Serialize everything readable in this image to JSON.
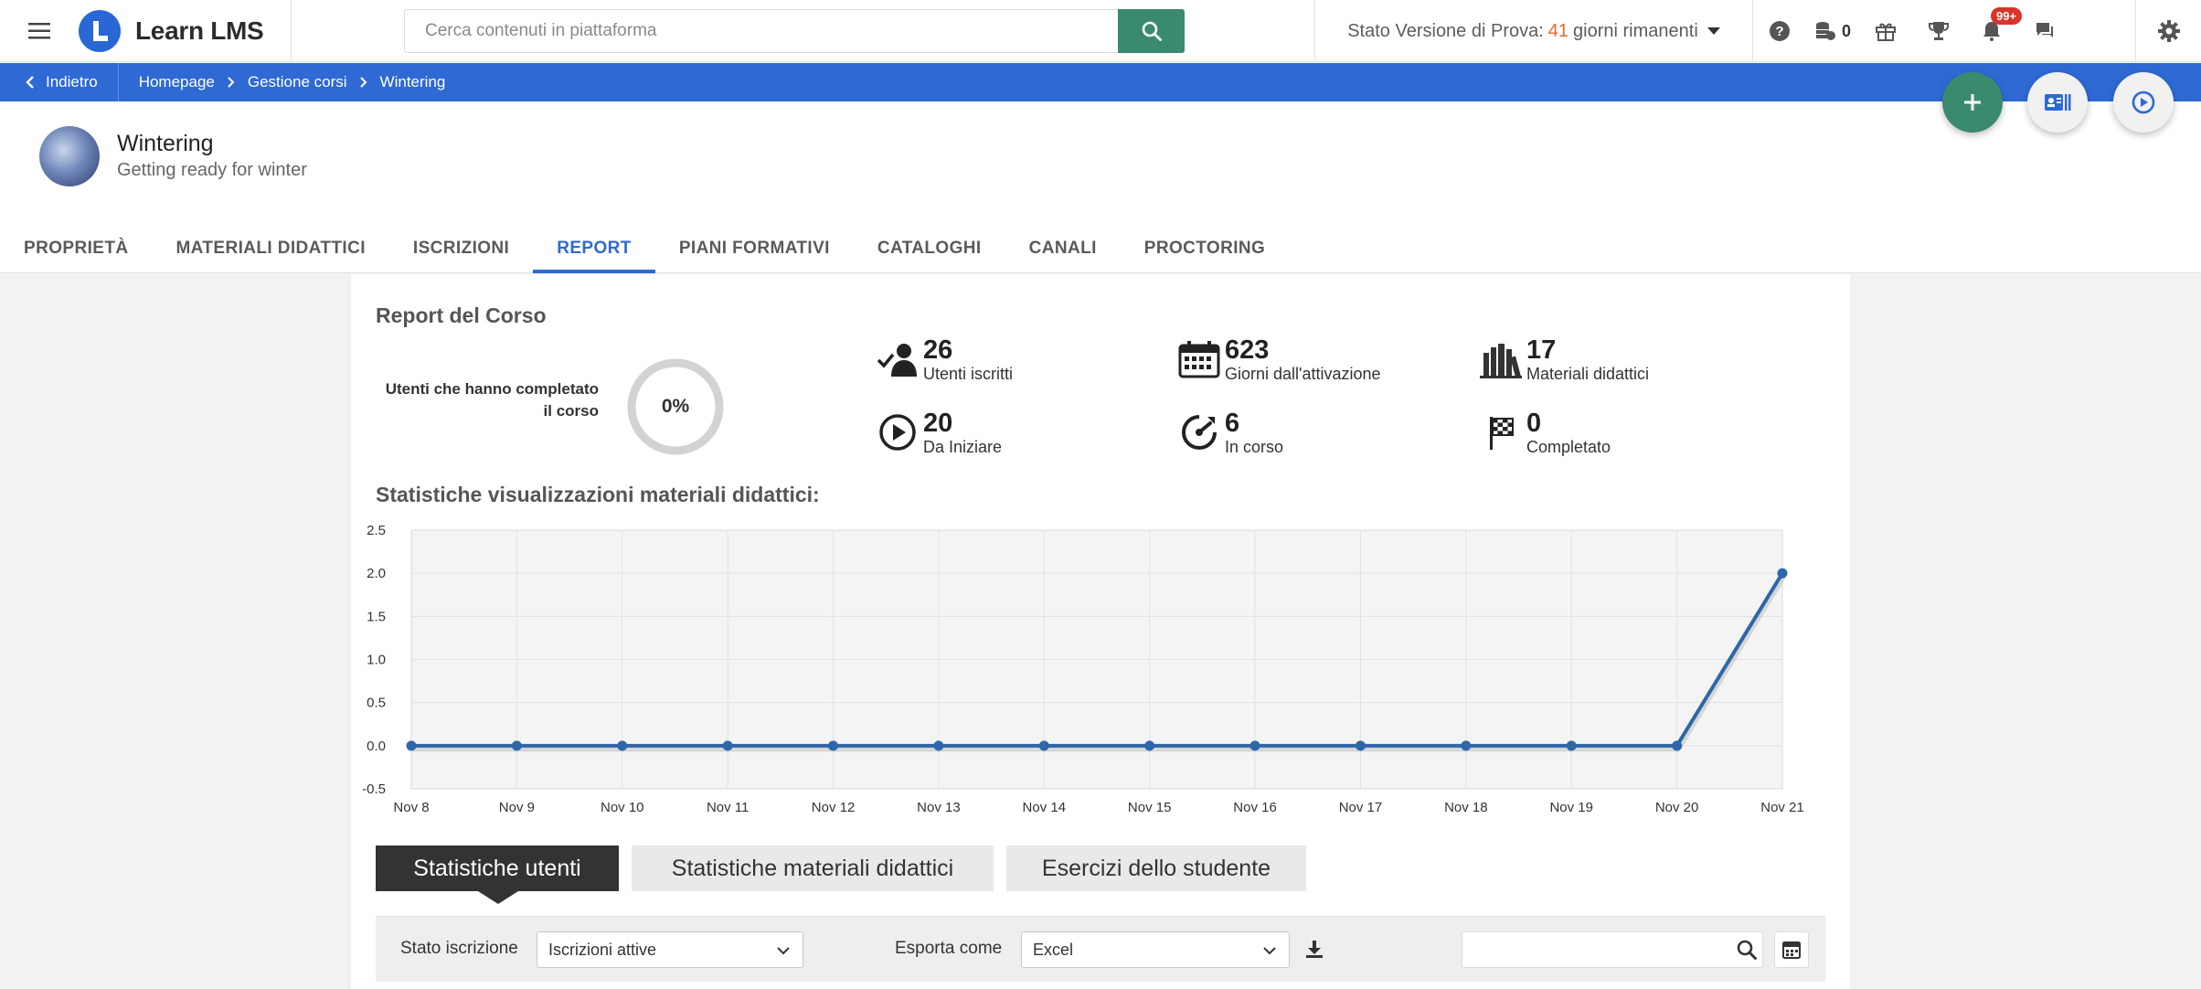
{
  "topbar": {
    "app_name": "Learn LMS",
    "search_placeholder": "Cerca contenuti in piattaforma",
    "trial_prefix": "Stato Versione di Prova:",
    "trial_days": "41",
    "trial_suffix": "giorni rimanenti",
    "coins_count": "0",
    "notifications_badge": "99+"
  },
  "breadcrumb": {
    "back_label": "Indietro",
    "items": [
      "Homepage",
      "Gestione corsi",
      "Wintering"
    ]
  },
  "course": {
    "title": "Wintering",
    "subtitle": "Getting ready for winter"
  },
  "tabs": [
    "PROPRIETÀ",
    "MATERIALI DIDATTICI",
    "ISCRIZIONI",
    "REPORT",
    "PIANI FORMATIVI",
    "CATALOGHI",
    "CANALI",
    "PROCTORING"
  ],
  "active_tab": "REPORT",
  "report": {
    "title": "Report del Corso",
    "completed_label": "Utenti che hanno completato il corso",
    "completed_percent": "0%",
    "completed_fraction": 0,
    "stats": {
      "enrolled": {
        "value": "26",
        "label": "Utenti iscritti",
        "icon": "user-check-icon"
      },
      "days": {
        "value": "623",
        "label": "Giorni dall'attivazione",
        "icon": "calendar-icon"
      },
      "materials": {
        "value": "17",
        "label": "Materiali didattici",
        "icon": "books-icon"
      },
      "to_start": {
        "value": "20",
        "label": "Da Iniziare",
        "icon": "play-circle-icon"
      },
      "in_progress": {
        "value": "6",
        "label": "In corso",
        "icon": "gauge-icon"
      },
      "completed": {
        "value": "0",
        "label": "Completato",
        "icon": "checkered-flag-icon"
      }
    }
  },
  "chart_title": "Statistiche visualizzazioni materiali didattici:",
  "chart_data": {
    "type": "line",
    "title": "",
    "xlabel": "",
    "ylabel": "",
    "categories": [
      "Nov 8",
      "Nov 9",
      "Nov 10",
      "Nov 11",
      "Nov 12",
      "Nov 13",
      "Nov 14",
      "Nov 15",
      "Nov 16",
      "Nov 17",
      "Nov 18",
      "Nov 19",
      "Nov 20",
      "Nov 21"
    ],
    "series": [
      {
        "values": [
          0,
          0,
          0,
          0,
          0,
          0,
          0,
          0,
          0,
          0,
          0,
          0,
          0,
          2
        ]
      }
    ],
    "ylim": [
      -0.5,
      2.5
    ],
    "yticks": [
      "2.5",
      "2.0",
      "1.5",
      "1.0",
      "0.5",
      "0.0",
      "-0.5"
    ],
    "grid": true,
    "line_color": "#2e67a8"
  },
  "subtabs": [
    "Statistiche utenti",
    "Statistiche materiali didattici",
    "Esercizi dello studente"
  ],
  "filters": {
    "status_label": "Stato iscrizione",
    "status_value": "Iscrizioni attive",
    "export_label": "Esporta come",
    "export_value": "Excel"
  },
  "colors": {
    "primary": "#2e69d4",
    "accent_green": "#3a8a6e",
    "trial_orange": "#e8692c"
  }
}
